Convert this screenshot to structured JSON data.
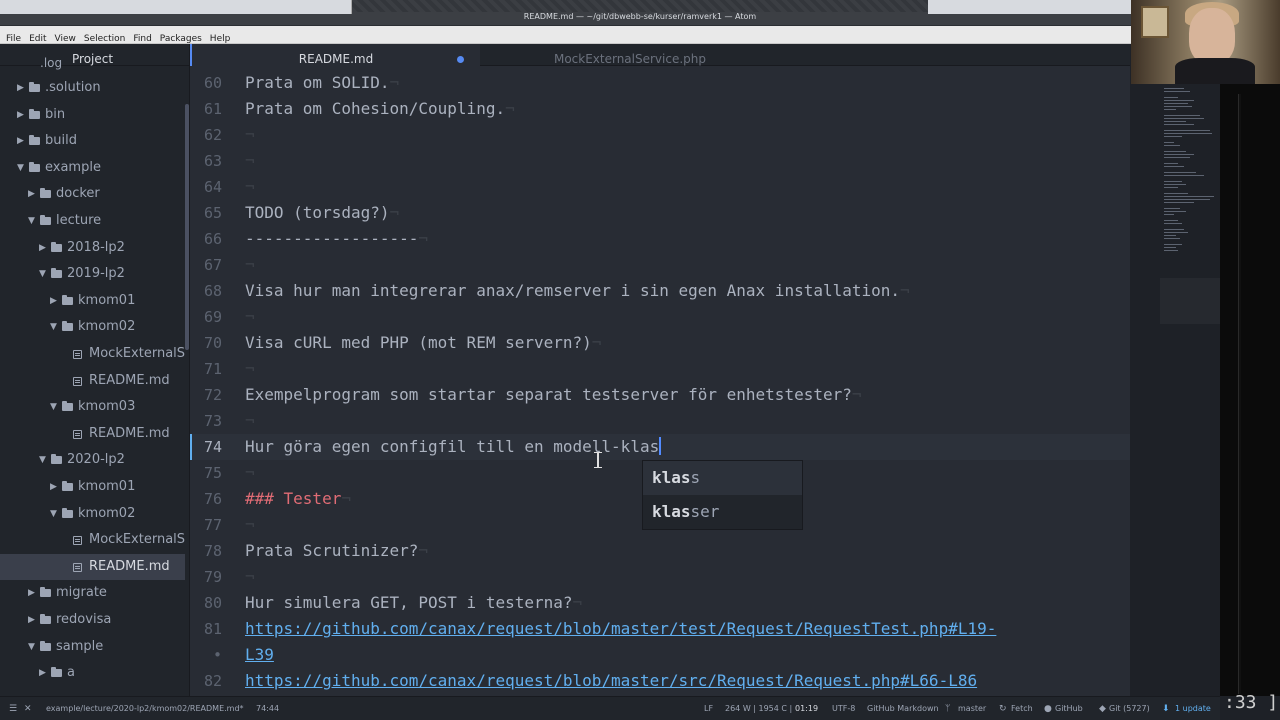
{
  "window": {
    "title": "README.md — ~/git/dbwebb-se/kurser/ramverk1 — Atom"
  },
  "menu": [
    "File",
    "Edit",
    "View",
    "Selection",
    "Find",
    "Packages",
    "Help"
  ],
  "tree": {
    "header": "Project",
    "header_behind": ".log",
    "items": [
      {
        "label": ".solution",
        "type": "folder",
        "open": false
      },
      {
        "label": "bin",
        "type": "folder",
        "open": false
      },
      {
        "label": "build",
        "type": "folder",
        "open": false
      },
      {
        "label": "example",
        "type": "folder",
        "open": true
      },
      {
        "label": "docker",
        "type": "folder",
        "open": false
      },
      {
        "label": "lecture",
        "type": "folder",
        "open": true
      },
      {
        "label": "2018-lp2",
        "type": "folder",
        "open": false
      },
      {
        "label": "2019-lp2",
        "type": "folder",
        "open": true
      },
      {
        "label": "kmom01",
        "type": "folder",
        "open": false
      },
      {
        "label": "kmom02",
        "type": "folder",
        "open": true
      },
      {
        "label": "MockExternalS",
        "type": "file"
      },
      {
        "label": "README.md",
        "type": "file"
      },
      {
        "label": "kmom03",
        "type": "folder",
        "open": true
      },
      {
        "label": "README.md",
        "type": "file"
      },
      {
        "label": "2020-lp2",
        "type": "folder",
        "open": true
      },
      {
        "label": "kmom01",
        "type": "folder",
        "open": false
      },
      {
        "label": "kmom02",
        "type": "folder",
        "open": true
      },
      {
        "label": "MockExternalS",
        "type": "file"
      },
      {
        "label": "README.md",
        "type": "file",
        "selected": true
      },
      {
        "label": "migrate",
        "type": "folder",
        "open": false
      },
      {
        "label": "redovisa",
        "type": "folder",
        "open": false
      },
      {
        "label": "sample",
        "type": "folder",
        "open": true
      },
      {
        "label": "a",
        "type": "folder",
        "open": false
      }
    ]
  },
  "tabs": [
    {
      "label": "README.md",
      "active": true,
      "modified": true
    },
    {
      "label": "MockExternalService.php",
      "active": false
    }
  ],
  "editor": {
    "lines": [
      {
        "num": "60",
        "text": "Prata om SOLID."
      },
      {
        "num": "61",
        "text": "Prata om Cohesion/Coupling."
      },
      {
        "num": "62",
        "text": ""
      },
      {
        "num": "63",
        "text": ""
      },
      {
        "num": "64",
        "text": ""
      },
      {
        "num": "65",
        "text": "TODO (torsdag?)"
      },
      {
        "num": "66",
        "text": "------------------"
      },
      {
        "num": "67",
        "text": ""
      },
      {
        "num": "68",
        "text": "Visa hur man integrerar anax/remserver i sin egen Anax installation."
      },
      {
        "num": "69",
        "text": ""
      },
      {
        "num": "70",
        "text": "Visa cURL med PHP (mot REM servern?)"
      },
      {
        "num": "71",
        "text": ""
      },
      {
        "num": "72",
        "text": "Exempelprogram som startar separat testserver för enhetstester?"
      },
      {
        "num": "73",
        "text": ""
      },
      {
        "num": "74",
        "text": "Hur göra egen configfil till en modell-klas",
        "cursor": true
      },
      {
        "num": "75",
        "text": ""
      },
      {
        "num": "76",
        "text": "### Tester",
        "heading": true
      },
      {
        "num": "77",
        "text": ""
      },
      {
        "num": "78",
        "text": "Prata Scrutinizer?"
      },
      {
        "num": "79",
        "text": ""
      },
      {
        "num": "80",
        "text": "Hur simulera GET, POST i testerna?"
      },
      {
        "num": "81",
        "text": "https://github.com/canax/request/blob/master/test/Request/RequestTest.php#L19-",
        "link": true
      },
      {
        "num": "•",
        "text": "L39",
        "link": true
      },
      {
        "num": "82",
        "text": "https://github.com/canax/request/blob/master/src/Request/Request.php#L66-L86",
        "link": true
      }
    ]
  },
  "autocomplete": {
    "typed_prefix": "klas",
    "suggestions": [
      {
        "match": "klas",
        "rest": "s"
      },
      {
        "match": "klas",
        "rest": "ser"
      }
    ]
  },
  "statusbar": {
    "path": "example/lecture/2020-lp2/kmom02/README.md*",
    "position": "74:44",
    "line_ending": "LF",
    "selection_info": "264 W | 1954 C |",
    "timer": "01:19",
    "encoding": "UTF-8",
    "grammar": "GitHub Markdown",
    "branch": "master",
    "fetch": "Fetch",
    "github": "GitHub",
    "git": "Git (5727)",
    "update": "1 update"
  },
  "clock": ":33 ]"
}
